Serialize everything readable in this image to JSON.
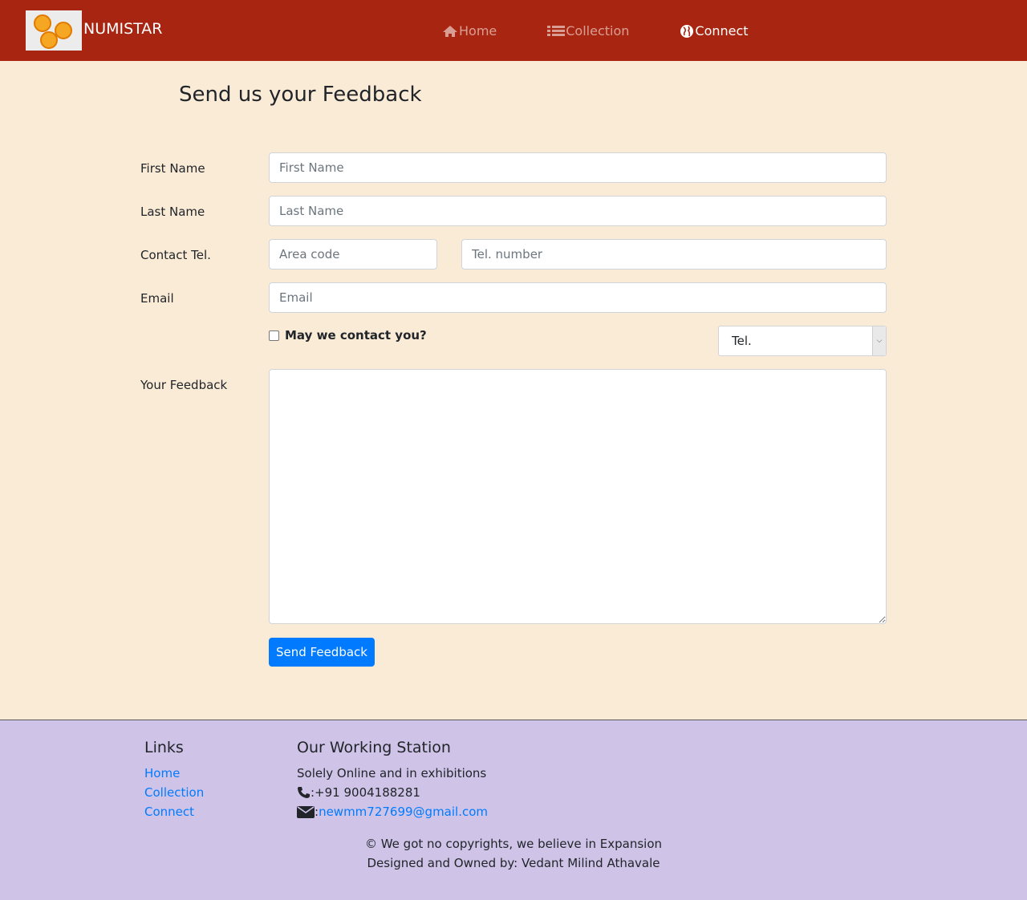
{
  "navbar": {
    "brand": "NUMISTAR",
    "items": [
      {
        "label": "Home",
        "icon": "home-icon"
      },
      {
        "label": "Collection",
        "icon": "list-icon"
      },
      {
        "label": "Connect",
        "icon": "globe-icon"
      }
    ]
  },
  "main": {
    "title": "Send us your Feedback",
    "form": {
      "first_name_label": "First Name",
      "first_name_placeholder": "First Name",
      "last_name_label": "Last Name",
      "last_name_placeholder": "Last Name",
      "contact_label": "Contact Tel.",
      "area_code_placeholder": "Area code",
      "tel_number_placeholder": "Tel. number",
      "email_label": "Email",
      "email_placeholder": "Email",
      "contact_checkbox_label": "May we contact you?",
      "contact_method_selected": "Tel.",
      "feedback_label": "Your Feedback",
      "submit_label": "Send Feedback"
    }
  },
  "footer": {
    "links_heading": "Links",
    "links": [
      "Home",
      "Collection",
      "Connect"
    ],
    "station_heading": "Our Working Station",
    "station_text": "Solely Online and in exhibitions",
    "phone": ":+91 9004188281",
    "email": "newmm727699@gmail.com",
    "copyright": "© We got no copyrights, we believe in Expansion",
    "owner": "Designed and Owned by: Vedant Milind Athavale"
  },
  "colors": {
    "navbar_bg": "#a82611",
    "page_bg": "#faebd7",
    "footer_bg": "#cfc4e8",
    "accent": "#007bff"
  }
}
